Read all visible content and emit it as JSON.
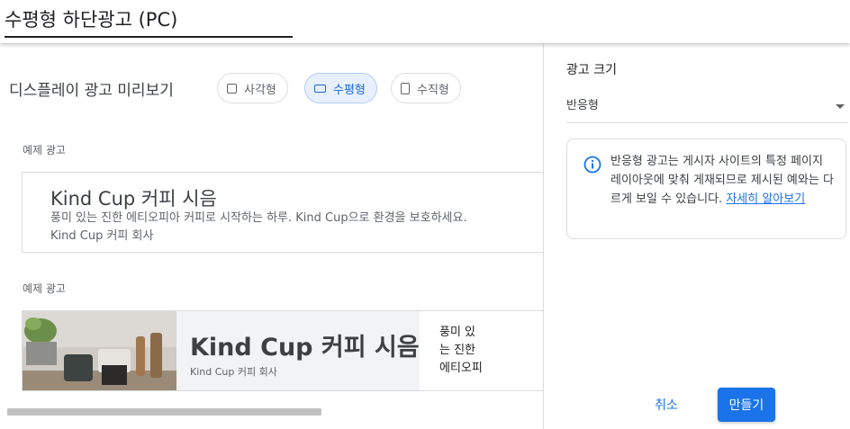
{
  "header": {
    "title": "수평형 하단광고 (PC)"
  },
  "preview": {
    "title": "디스플레이 광고 미리보기",
    "chips": [
      {
        "label": "사각형",
        "selected": false
      },
      {
        "label": "수평형",
        "selected": true
      },
      {
        "label": "수직형",
        "selected": false
      }
    ]
  },
  "examples": [
    {
      "label": "예제 광고",
      "headline": "Kind Cup 커피 시음",
      "description": "풍미 있는 진한 에티오피아 커피로 시작하는 하루. Kind Cup으로 환경을 보호하세요. Kind Cup 커피 회사"
    },
    {
      "label": "예제 광고",
      "headline": "Kind Cup 커피 시음",
      "brand": "Kind Cup 커피 회사",
      "side_text": "풍미 있는 진한 에티오피아 커피로 시작하는 하루"
    }
  ],
  "settings": {
    "size_label": "광고 크기",
    "size_value": "반응형",
    "info_text": "반응형 광고는 게시자 사이트의 특정 페이지 레이아웃에 맞춰 게재되므로 제시된 예와는 다르게 보일 수 있습니다.",
    "info_link": "자세히 알아보기"
  },
  "footer": {
    "cancel_label": "취소",
    "create_label": "만들기"
  },
  "colors": {
    "accent": "#1a73e8",
    "chip_selected_bg": "#e8f0fe"
  }
}
